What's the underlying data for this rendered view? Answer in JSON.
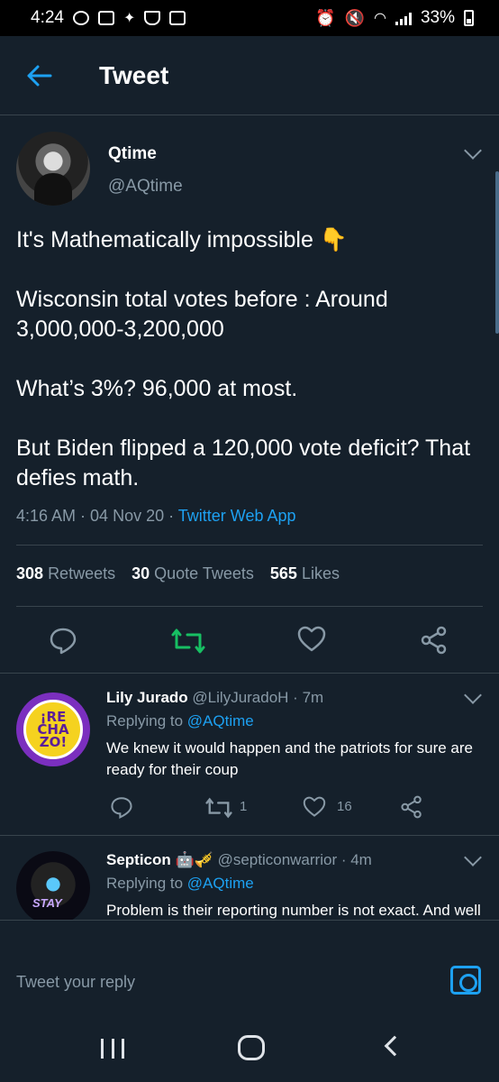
{
  "status_bar": {
    "time": "4:24",
    "battery": "33%"
  },
  "header": {
    "title": "Tweet"
  },
  "tweet": {
    "name": "Qtime",
    "handle": "@AQtime",
    "text": "It's Mathematically impossible 👇\n\nWisconsin total votes before : Around 3,000,000-3,200,000\n\nWhat’s 3%? 96,000 at most.\n\nBut Biden flipped a 120,000 vote deficit? That defies math.",
    "time": "4:16 AM",
    "date": "04 Nov 20",
    "source": "Twitter Web App",
    "retweets_count": "308",
    "retweets_label": "Retweets",
    "quotes_count": "30",
    "quotes_label": "Quote Tweets",
    "likes_count": "565",
    "likes_label": "Likes"
  },
  "replies": [
    {
      "name": "Lily Jurado",
      "handle": "@LilyJuradoH",
      "time": "7m",
      "replying_prefix": "Replying to",
      "replying_to": "@AQtime",
      "text": "We knew it would happen and the patriots for sure are ready for their coup",
      "retweets": "1",
      "likes": "16",
      "avatar_text": [
        "¡RE",
        "CHA",
        "ZO!"
      ]
    },
    {
      "name": "Septicon 🤖🎺",
      "handle": "@septiconwarrior",
      "time": "4m",
      "replying_prefix": "Replying to",
      "replying_to": "@AQtime",
      "text": "Problem is their reporting number is not exact. And well if they find mysterious box of ballots in the",
      "avatar_text": "STAY"
    }
  ],
  "compose": {
    "placeholder": "Tweet your reply"
  },
  "colors": {
    "background": "#15202b",
    "accent": "#1da1f2",
    "retweet_green": "#17bf63",
    "muted": "#8899a6"
  }
}
